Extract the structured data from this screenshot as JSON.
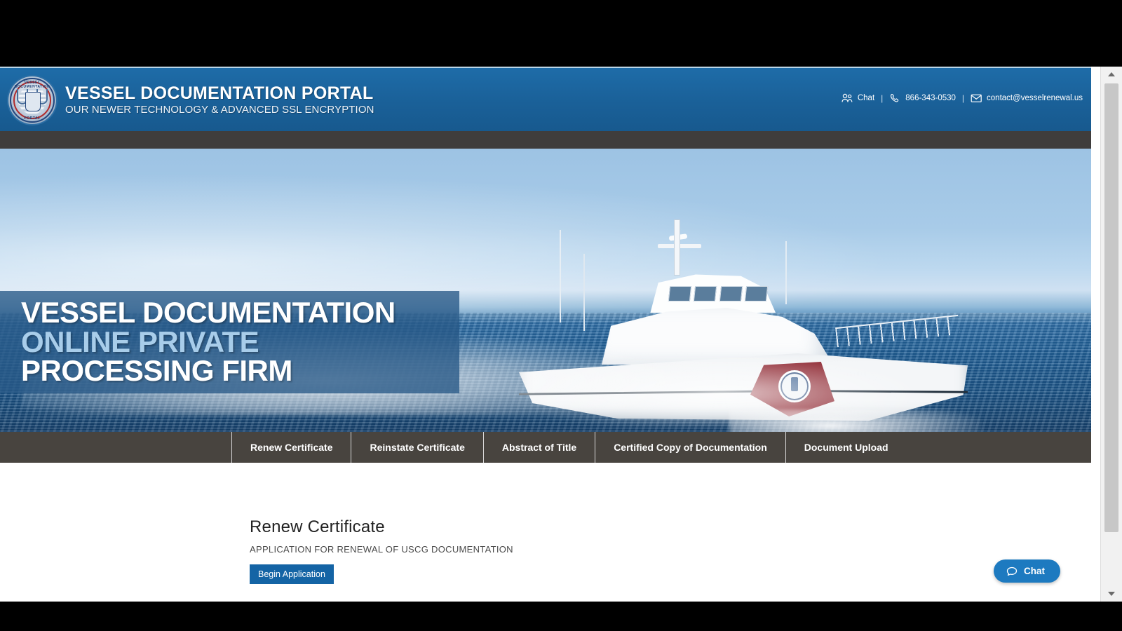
{
  "header": {
    "brand_title": "VESSEL DOCUMENTATION PORTAL",
    "brand_subtitle": "OUR NEWER TECHNOLOGY & ADVANCED SSL ENCRYPTION",
    "logo_text_top": "VESSEL DOCUMENTATION",
    "logo_text_bottom": "PORTAL",
    "contacts": {
      "chat_label": "Chat",
      "separator": "|",
      "phone": "866-343-0530",
      "email": "contact@vesselrenewal.us"
    }
  },
  "hero": {
    "line1": "VESSEL DOCUMENTATION",
    "line2": "ONLINE PRIVATE",
    "line3": "PROCESSING FIRM",
    "caption_bg": "#285886",
    "accent_color": "#a8cdea"
  },
  "nav": {
    "items": [
      {
        "label": "Renew Certificate"
      },
      {
        "label": "Reinstate Certificate"
      },
      {
        "label": "Abstract of Title"
      },
      {
        "label": "Certified Copy of Documentation"
      },
      {
        "label": "Document Upload"
      }
    ]
  },
  "main": {
    "title": "Renew Certificate",
    "subtitle": "APPLICATION FOR RENEWAL OF USCG DOCUMENTATION",
    "button_label": "Begin Application",
    "button_color": "#1464a5"
  },
  "chat_widget": {
    "label": "Chat",
    "color": "#1d7ac0"
  },
  "theme": {
    "header_blue": "#1a6098",
    "dark_bar": "#3f3d3c",
    "nav_bar": "#48443f"
  }
}
